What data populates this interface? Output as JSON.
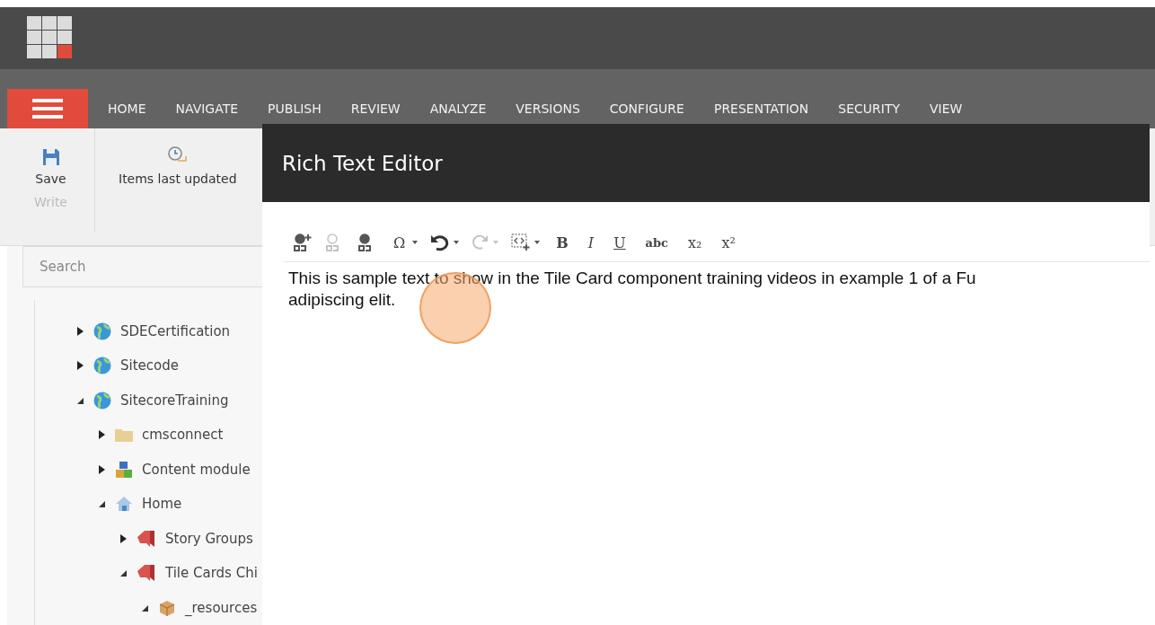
{
  "nav": {
    "tabs": [
      {
        "label": "HOME",
        "selected": false
      },
      {
        "label": "NAVIGATE",
        "selected": false
      },
      {
        "label": "PUBLISH",
        "selected": false
      },
      {
        "label": "REVIEW",
        "selected": false
      },
      {
        "label": "ANALYZE",
        "selected": false
      },
      {
        "label": "VERSIONS",
        "selected": false
      },
      {
        "label": "CONFIGURE",
        "selected": false
      },
      {
        "label": "PRESENTATION",
        "selected": false
      },
      {
        "label": "SECURITY",
        "selected": false
      },
      {
        "label": "VIEW",
        "selected": false
      }
    ]
  },
  "ribbon": {
    "save_label": "Save",
    "group_label": "Write",
    "items_label": "Items last updated"
  },
  "search": {
    "placeholder": "Search"
  },
  "tree": [
    {
      "label": "SDECertification",
      "kind": "globe",
      "expanded": false
    },
    {
      "label": "Sitecode",
      "kind": "globe",
      "expanded": false
    },
    {
      "label": "SitecoreTraining",
      "kind": "globe",
      "expanded": true,
      "children": [
        {
          "label": "cmsconnect",
          "kind": "folder",
          "expanded": false
        },
        {
          "label": "Content module",
          "kind": "modules",
          "expanded": false
        },
        {
          "label": "Home",
          "kind": "home",
          "expanded": true,
          "children": [
            {
              "label": "Story Groups",
              "kind": "bookmark",
              "expanded": false
            },
            {
              "label": "Tile Cards Chi",
              "kind": "bookmark",
              "expanded": true,
              "children": [
                {
                  "label": "_resources",
                  "kind": "box",
                  "expanded": true
                }
              ]
            }
          ]
        }
      ]
    }
  ],
  "dialog": {
    "title": "Rich Text Editor",
    "toolbar": [
      {
        "kind": "link-add",
        "disabled": false,
        "dropdown": false
      },
      {
        "kind": "link-remove",
        "disabled": true,
        "dropdown": false
      },
      {
        "kind": "link-edit",
        "disabled": false,
        "dropdown": false
      },
      {
        "kind": "symbol",
        "text": "Ω",
        "disabled": false,
        "dropdown": true
      },
      {
        "kind": "undo",
        "disabled": false,
        "dropdown": true
      },
      {
        "kind": "redo",
        "disabled": true,
        "dropdown": true
      },
      {
        "kind": "snippet",
        "disabled": false,
        "dropdown": true
      },
      {
        "kind": "bold",
        "text": "B",
        "disabled": false,
        "dropdown": false
      },
      {
        "kind": "italic",
        "text": "I",
        "disabled": false,
        "dropdown": false
      },
      {
        "kind": "underline",
        "text": "U",
        "disabled": false,
        "dropdown": false
      },
      {
        "kind": "strike",
        "text": "abc",
        "disabled": false,
        "dropdown": false
      },
      {
        "kind": "subscript",
        "text": "x₂",
        "disabled": false,
        "dropdown": false
      },
      {
        "kind": "superscript",
        "text": "x²",
        "disabled": false,
        "dropdown": false
      }
    ],
    "content_lines": [
      "This is sample text to show in the Tile Card component training videos in example 1 of a Fu",
      "adipiscing elit."
    ]
  }
}
